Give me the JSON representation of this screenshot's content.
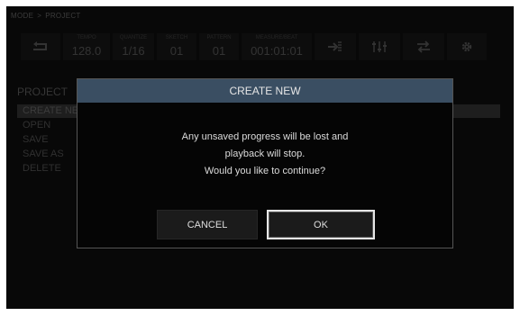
{
  "breadcrumb": {
    "parent": "MODE",
    "current": "PROJECT"
  },
  "toolbar": {
    "back_icon": "return-arrow-icon",
    "fields": [
      {
        "label": "TEMPO",
        "value": "128.0"
      },
      {
        "label": "QUANTIZE",
        "value": "1/16"
      },
      {
        "label": "SKETCH",
        "value": "01"
      },
      {
        "label": "PATTERN",
        "value": "01"
      },
      {
        "label": "MEASURE/BEAT",
        "value": "001:01:01"
      }
    ],
    "icons": [
      "import-icon",
      "sliders-icon",
      "transfer-icon",
      "gear-icon"
    ]
  },
  "project_menu": {
    "title": "PROJECT",
    "items": [
      "CREATE NEW",
      "OPEN",
      "SAVE",
      "SAVE AS",
      "DELETE"
    ],
    "selected_index": 0
  },
  "dialog": {
    "title": "CREATE NEW",
    "message_line1": "Any unsaved progress will be lost and",
    "message_line2": "playback will stop.",
    "message_line3": "Would you like to continue?",
    "cancel_label": "CANCEL",
    "ok_label": "OK"
  },
  "colors": {
    "dialog_header": "#3a4e62",
    "background": "#0d0d0d",
    "focus_border": "#e6e6e6"
  }
}
